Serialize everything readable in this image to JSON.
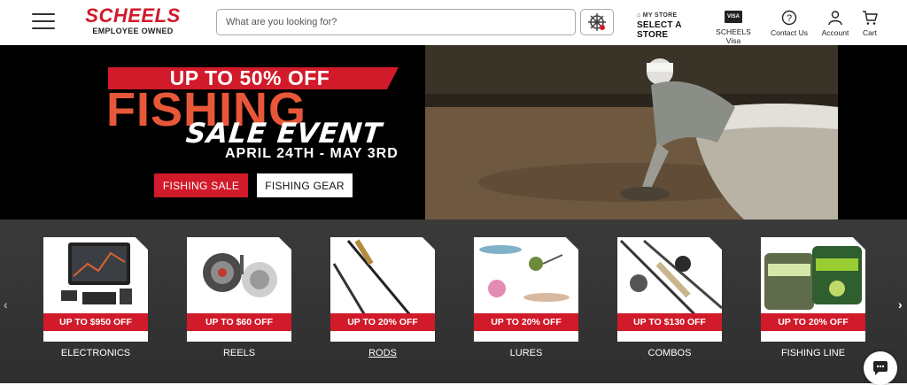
{
  "header": {
    "brand": "SCHEELS",
    "tagline": "EMPLOYEE OWNED",
    "search_placeholder": "What are you looking for?",
    "store_small": "MY STORE",
    "store_label": "SELECT A STORE",
    "visa_badge": "VISA",
    "visa_label": "SCHEELS Visa",
    "contact_label": "Contact Us",
    "account_label": "Account",
    "cart_label": "Cart"
  },
  "hero": {
    "banner": "UP TO 50% OFF",
    "headline": "FISHING",
    "subhead": "SALE EVENT",
    "dates": "APRIL 24TH - MAY 3RD",
    "cta_primary": "FISHING SALE",
    "cta_secondary": "FISHING GEAR"
  },
  "categories": [
    {
      "label": "ELECTRONICS",
      "offer": "UP TO $950 OFF"
    },
    {
      "label": "REELS",
      "offer": "UP TO $60 OFF"
    },
    {
      "label": "RODS",
      "offer": "UP TO 20% OFF"
    },
    {
      "label": "LURES",
      "offer": "UP TO 20% OFF"
    },
    {
      "label": "COMBOS",
      "offer": "UP TO $130 OFF"
    },
    {
      "label": "FISHING LINE",
      "offer": "UP TO 20% OFF"
    }
  ],
  "colors": {
    "brand_red": "#d11a2a",
    "hero_orange": "#e8573a",
    "dark_band": "#333333"
  },
  "icons": [
    "menu-icon",
    "helm-icon",
    "home-icon",
    "visa-card-icon",
    "help-circle-icon",
    "user-icon",
    "cart-icon",
    "chevron-left-icon",
    "chevron-right-icon",
    "chat-icon"
  ]
}
